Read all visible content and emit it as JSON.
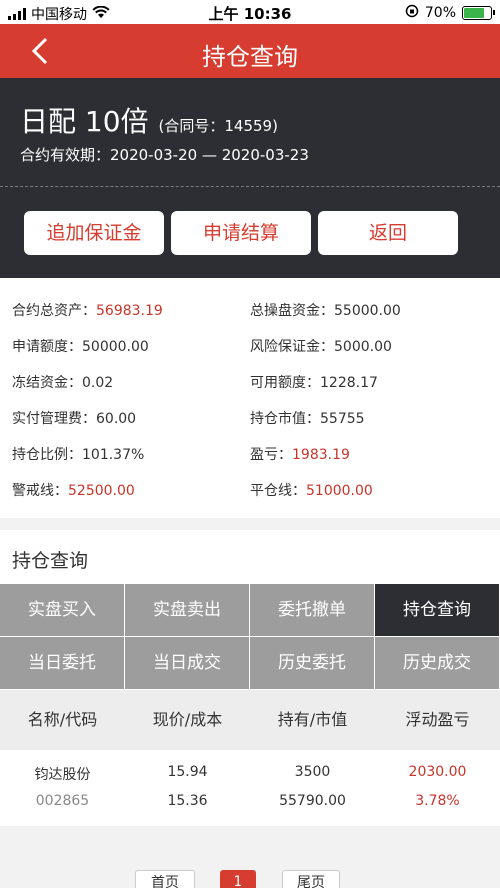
{
  "status_bar": {
    "carrier": "中国移动",
    "time": "上午 10:36",
    "battery": "70%"
  },
  "nav": {
    "title": "持仓查询"
  },
  "header": {
    "contract_title": "日配 10倍",
    "contract_no": "(合同号：14559)",
    "validity": "合约有效期：2020-03-20 — 2020-03-23"
  },
  "actions": [
    "追加保证金",
    "申请结算",
    "返回"
  ],
  "info": [
    {
      "label": "合约总资产：",
      "value": "56983.19",
      "red": true
    },
    {
      "label": "总操盘资金：",
      "value": "55000.00",
      "red": false
    },
    {
      "label": "申请额度：",
      "value": "50000.00",
      "red": false
    },
    {
      "label": "风险保证金：",
      "value": "5000.00",
      "red": false
    },
    {
      "label": "冻结资金：",
      "value": "0.02",
      "red": false
    },
    {
      "label": "可用额度：",
      "value": "1228.17",
      "red": false
    },
    {
      "label": "实付管理费：",
      "value": "60.00",
      "red": false
    },
    {
      "label": "持仓市值：",
      "value": "55755",
      "red": false
    },
    {
      "label": "持仓比例：",
      "value": "101.37%",
      "red": false
    },
    {
      "label": "盈亏：",
      "value": "1983.19",
      "red": true
    },
    {
      "label": "警戒线：",
      "value": "52500.00",
      "red": true
    },
    {
      "label": "平仓线：",
      "value": "51000.00",
      "red": true
    }
  ],
  "section_title": "持仓查询",
  "tabs": [
    "实盘买入",
    "实盘卖出",
    "委托撤单",
    "持仓查询",
    "当日委托",
    "当日成交",
    "历史委托",
    "历史成交"
  ],
  "active_tab": 3,
  "table": {
    "headers": [
      "名称/代码",
      "现价/成本",
      "持有/市值",
      "浮动盈亏"
    ],
    "rows": [
      {
        "name": "钧达股份",
        "code": "002865",
        "price": "15.94",
        "cost": "15.36",
        "hold": "3500",
        "market_value": "55790.00",
        "pnl": "2030.00",
        "pnl_pct": "3.78%"
      }
    ]
  },
  "pager": {
    "first": "首页",
    "current": "1",
    "last": "尾页"
  },
  "colors": {
    "brand_red": "#d73c30",
    "dark": "#2d2e33",
    "tab_gray": "#9d9d9d"
  }
}
